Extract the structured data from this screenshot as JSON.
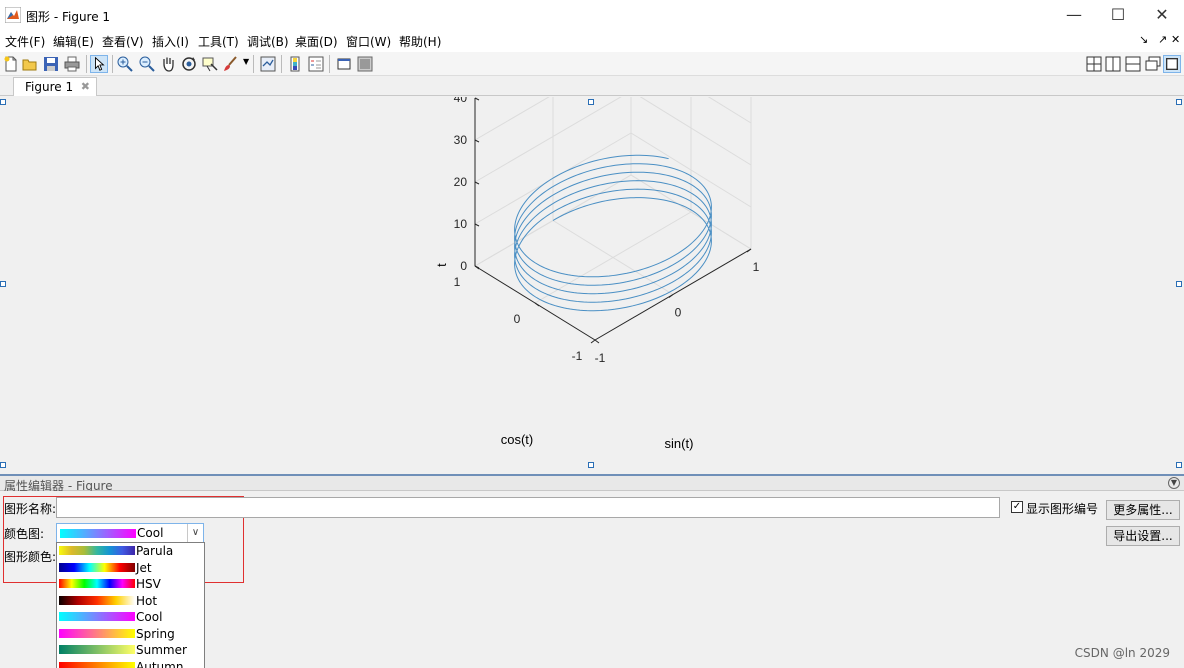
{
  "window": {
    "title": "图形 - Figure 1"
  },
  "menu": [
    "文件(F)",
    "编辑(E)",
    "查看(V)",
    "插入(I)",
    "工具(T)",
    "调试(B)",
    "桌面(D)",
    "窗口(W)",
    "帮助(H)"
  ],
  "tab": {
    "label": "Figure 1"
  },
  "chart_data": {
    "type": "line",
    "projection": "3d",
    "curve": "helix: x = sin(t), y = cos(t), z = t",
    "t_range": [
      0,
      10.5
    ],
    "num_turns": 5.2,
    "series": [
      {
        "color": "#4a8fc4"
      }
    ],
    "xlabel": "sin(t)",
    "ylabel": "cos(t)",
    "zlabel": "t",
    "x_ticks": [
      "-1",
      "0",
      "1"
    ],
    "y_ticks": [
      "-1",
      "0",
      "1"
    ],
    "z_ticks": [
      "0",
      "10",
      "20",
      "30",
      "40"
    ],
    "xlim": [
      -1,
      1
    ],
    "ylim": [
      -1,
      1
    ],
    "zlim": [
      0,
      40
    ],
    "grid": true
  },
  "property_editor": {
    "title": "属性编辑器 - Figure",
    "figure_name_label": "图形名称:",
    "figure_name_value": "",
    "colormap_label": "颜色图:",
    "colormap_selected": "Cool",
    "figure_color_label": "图形颜色:",
    "show_number_label": "显示图形编号",
    "show_number_checked": true,
    "more_properties_button": "更多属性...",
    "export_settings_button": "导出设置...",
    "colormap_options": [
      "Parula",
      "Jet",
      "HSV",
      "Hot",
      "Cool",
      "Spring",
      "Summer",
      "Autumn"
    ]
  },
  "watermark": "CSDN @ln 2029"
}
